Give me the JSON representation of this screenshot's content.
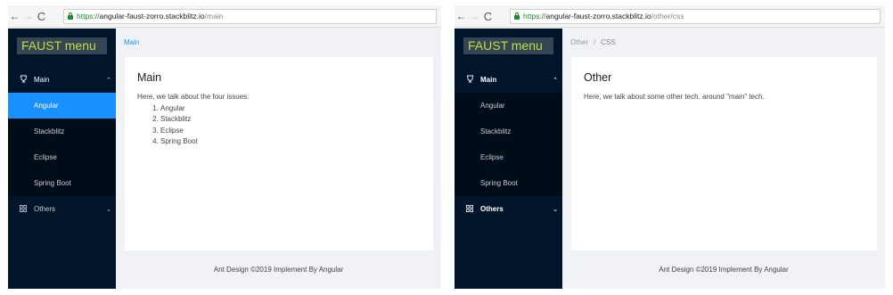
{
  "left": {
    "url": {
      "scheme": "https://",
      "host": "angular-faust-zorro.stackblitz.io",
      "path": "/main"
    },
    "logo": "FAUST menu",
    "menu": {
      "main_label": "Main",
      "items": [
        "Angular",
        "Stackblitz",
        "Eclipse",
        "Spring Boot"
      ],
      "others_label": "Others"
    },
    "breadcrumb": [
      "Main"
    ],
    "card": {
      "title": "Main",
      "text": "Here, we talk about the four issues:",
      "list": [
        "Angular",
        "Stackblitz",
        "Eclipse",
        "Spring Boot"
      ]
    },
    "footer": "Ant Design ©2019 Implement By Angular"
  },
  "right": {
    "url": {
      "scheme": "https://",
      "host": "angular-faust-zorro.stackblitz.io",
      "path": "/other/css"
    },
    "logo": "FAUST menu",
    "menu": {
      "main_label": "Main",
      "items": [
        "Angular",
        "Stackblitz",
        "Eclipse",
        "Spring Boot"
      ],
      "others_label": "Others"
    },
    "breadcrumb": [
      "Other",
      "CSS"
    ],
    "card": {
      "title": "Other",
      "text": "Here, we talk about some other tech. around \"main\" tech."
    },
    "footer": "Ant Design ©2019 Implement By Angular"
  },
  "icons": {
    "back": "←",
    "forward": "→",
    "reload": "C",
    "main_menu_icon": "trophy-icon",
    "others_menu_icon": "appstore-icon",
    "expanded_arrow": "⌃",
    "collapsed_arrow": "⌄"
  },
  "colors": {
    "sider": "#001529",
    "submenu": "#000c17",
    "active": "#1890ff",
    "logo_text": "#bfe03a",
    "page_bg": "#f0f2f5"
  }
}
